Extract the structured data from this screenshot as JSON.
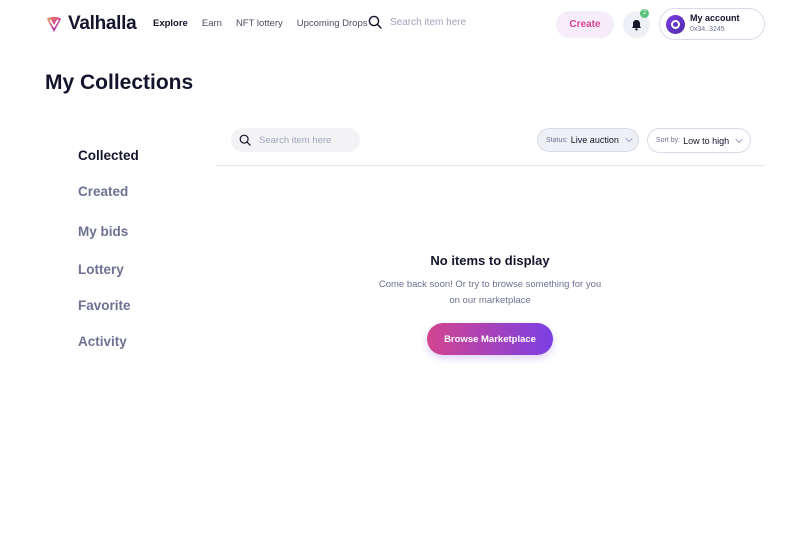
{
  "brand": {
    "name": "Valhalla",
    "accent_start": "#d3458f",
    "accent_end": "#7b3fe4"
  },
  "nav": {
    "items": [
      "Explore",
      "Earn",
      "NFT lottery",
      "Upcoming Drops"
    ],
    "active": "Explore"
  },
  "header": {
    "search_placeholder": "Search item here",
    "create_label": "Create",
    "notification_count": "2",
    "account_name": "My account",
    "account_address": "0x34..3245"
  },
  "page": {
    "title": "My Collections"
  },
  "sidebar": {
    "items": [
      {
        "label": "Collected",
        "active": true
      },
      {
        "label": "Created",
        "active": false
      },
      {
        "label": "My bids",
        "active": false
      },
      {
        "label": "Lottery",
        "active": false
      },
      {
        "label": "Favorite",
        "active": false
      },
      {
        "label": "Activity",
        "active": false
      }
    ]
  },
  "filters": {
    "search_placeholder": "Search item here",
    "status_label": "Status:",
    "status_value": "Live auction",
    "sort_label": "Sort by:",
    "sort_value": "Low to high"
  },
  "empty_state": {
    "title": "No items to display",
    "line1": "Come back soon! Or try to browse something for you",
    "line2": "on our marketplace",
    "button_label": "Browse Marketplace"
  }
}
